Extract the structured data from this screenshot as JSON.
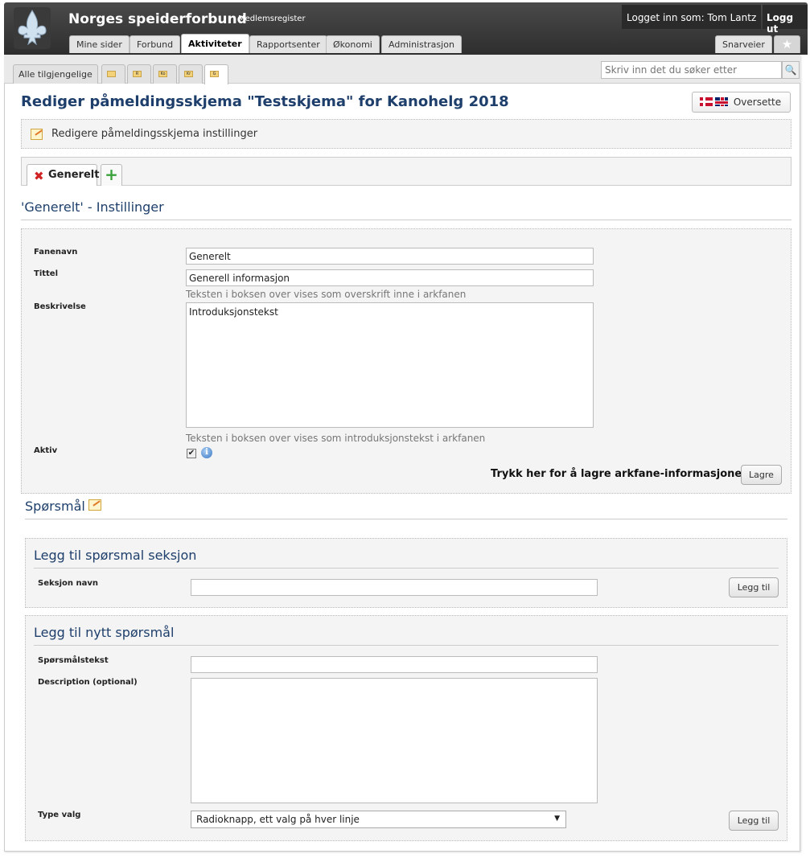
{
  "header": {
    "brand": "Norges speiderforbund",
    "brand_sub": "Medlemsregister",
    "user_label": "Logget inn som: Tom Lantz",
    "logout_label": "Logg ut",
    "tabs": [
      {
        "label": "Mine sider"
      },
      {
        "label": "Forbund"
      },
      {
        "label": "Aktiviteter"
      },
      {
        "label": "Rapportsenter"
      },
      {
        "label": "Økonomi"
      },
      {
        "label": "Administrasjon"
      }
    ],
    "shortcuts_label": "Snarveier",
    "star_icon": "★"
  },
  "subtabs": {
    "all_label": "Alle tilgjengelige",
    "mini_labels": [
      "",
      "R",
      "Ko",
      "Kr",
      "G"
    ]
  },
  "search": {
    "placeholder": "Skriv inn det du søker etter",
    "icon": "search-icon"
  },
  "page": {
    "title": "Rediger påmeldingsskjema \"Testskjema\" for Kanohelg 2018",
    "translate_label": "Oversette"
  },
  "settings_bar": {
    "label": "Redigere påmeldingsskjema instillinger"
  },
  "form_tabs": {
    "tab_label": "Generelt",
    "add_icon": "+"
  },
  "tab_settings": {
    "heading": "'Generelt' - Instillinger",
    "fanenavn_label": "Fanenavn",
    "fanenavn_value": "Generelt",
    "tittel_label": "Tittel",
    "tittel_value": "Generell informasjon",
    "tittel_help": "Teksten i boksen over vises som overskrift inne i arkfanen",
    "beskrivelse_label": "Beskrivelse",
    "beskrivelse_value": "Introduksjonstekst",
    "beskrivelse_help": "Teksten i boksen over vises som introduksjonstekst i arkfanen",
    "aktiv_label": "Aktiv",
    "aktiv_checked": "✔",
    "info_glyph": "i",
    "save_prompt": "Trykk her for å lagre arkfane-informasjonen",
    "save_label": "Lagre"
  },
  "questions": {
    "heading": "Spørsmål",
    "section": {
      "heading": "Legg til spørsmal seksjon",
      "name_label": "Seksjon navn",
      "name_value": "",
      "add_label": "Legg til"
    },
    "new_question": {
      "heading": "Legg til nytt spørsmål",
      "text_label": "Spørsmålstekst",
      "text_value": "",
      "description_label": "Description (optional)",
      "description_value": "",
      "type_label": "Type valg",
      "type_value": "Radioknapp, ett valg på hver linje",
      "type_arrow": "▼",
      "add_label": "Legg til"
    }
  }
}
